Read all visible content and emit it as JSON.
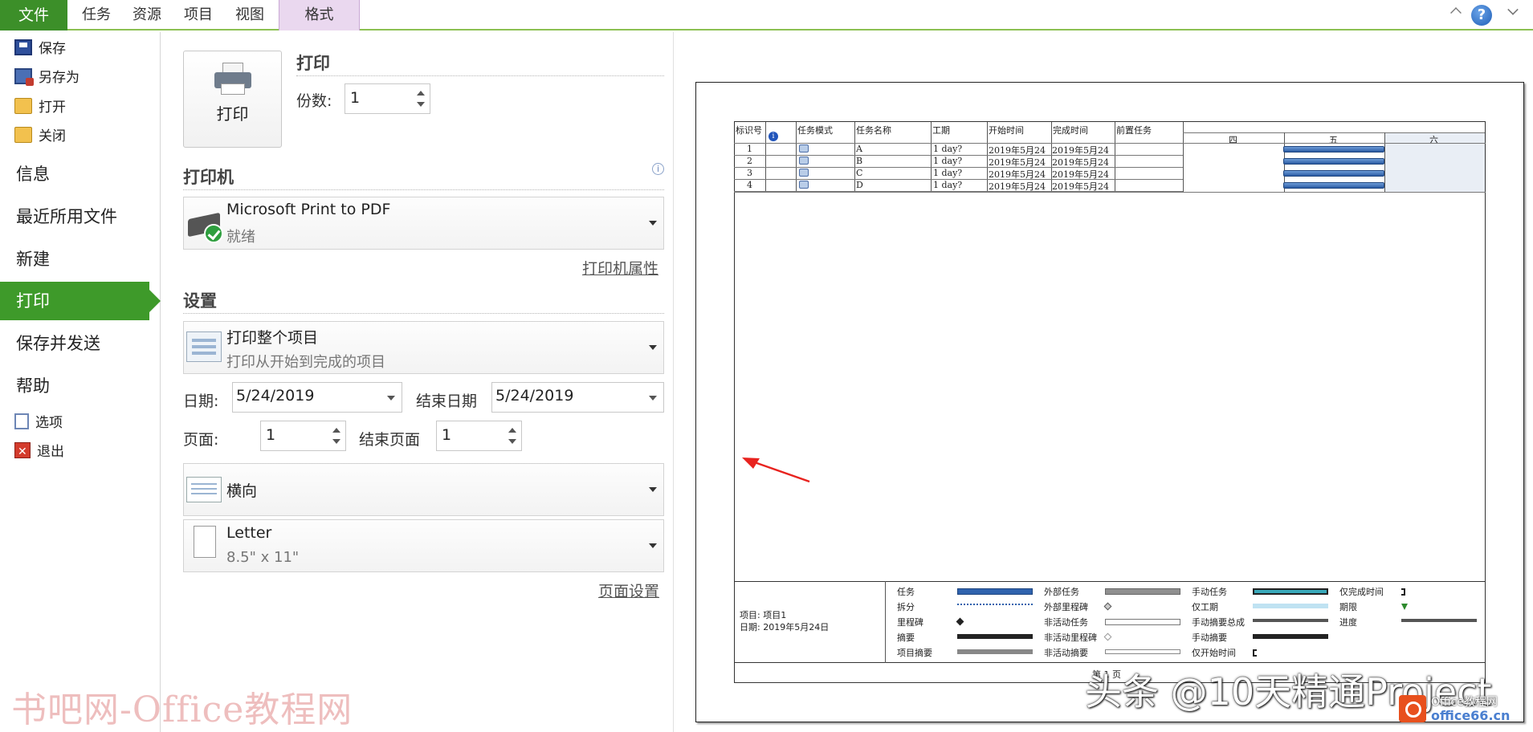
{
  "ribbon": {
    "file_tab": "文件",
    "tabs": [
      "任务",
      "资源",
      "项目",
      "视图"
    ],
    "context_tab": "格式"
  },
  "nav": {
    "commands_top": [
      {
        "label": "保存",
        "icon": "save-icon"
      },
      {
        "label": "另存为",
        "icon": "save-as-icon"
      },
      {
        "label": "打开",
        "icon": "open-folder-icon"
      },
      {
        "label": "关闭",
        "icon": "close-folder-icon"
      }
    ],
    "items": [
      "信息",
      "最近所用文件",
      "新建",
      "打印",
      "保存并发送",
      "帮助"
    ],
    "active_item": "打印",
    "commands_bottom": [
      {
        "label": "选项",
        "icon": "options-icon"
      },
      {
        "label": "退出",
        "icon": "exit-icon"
      }
    ]
  },
  "print": {
    "button_label": "打印",
    "section_title": "打印",
    "copies_label": "份数:",
    "copies_value": "1"
  },
  "printer": {
    "section_title": "打印机",
    "name": "Microsoft Print to PDF",
    "status": "就绪",
    "properties_link": "打印机属性"
  },
  "settings": {
    "section_title": "设置",
    "range_title": "打印整个项目",
    "range_desc": "打印从开始到完成的项目",
    "date_label": "日期:",
    "date_value": "5/24/2019",
    "end_date_label": "结束日期",
    "end_date_value": "5/24/2019",
    "page_label": "页面:",
    "page_value": "1",
    "end_page_label": "结束页面",
    "end_page_value": "1",
    "orientation": "横向",
    "paper_name": "Letter",
    "paper_size": "8.5\" x 11\"",
    "page_setup_link": "页面设置"
  },
  "preview": {
    "columns": [
      "标识号",
      "任务模式",
      "任务名称",
      "工期",
      "开始时间",
      "完成时间",
      "前置任务"
    ],
    "timescale": [
      "四",
      "五",
      "六"
    ],
    "rows": [
      {
        "id": "1",
        "name": "A",
        "duration": "1 day?",
        "start": "2019年5月24",
        "finish": "2019年5月24"
      },
      {
        "id": "2",
        "name": "B",
        "duration": "1 day?",
        "start": "2019年5月24",
        "finish": "2019年5月24"
      },
      {
        "id": "3",
        "name": "C",
        "duration": "1 day?",
        "start": "2019年5月24",
        "finish": "2019年5月24"
      },
      {
        "id": "4",
        "name": "D",
        "duration": "1 day?",
        "start": "2019年5月24",
        "finish": "2019年5月24"
      }
    ],
    "project_label": "项目: 项目1",
    "date_label": "日期: 2019年5月24日",
    "legend_col1": [
      "任务",
      "拆分",
      "里程碑",
      "摘要",
      "项目摘要"
    ],
    "legend_col2": [
      "外部任务",
      "外部里程碑",
      "非活动任务",
      "非活动里程碑",
      "非活动摘要"
    ],
    "legend_col3": [
      "手动任务",
      "仅工期",
      "手动摘要总成",
      "手动摘要",
      "仅开始时间"
    ],
    "legend_col4": [
      "仅完成时间",
      "期限",
      "进度"
    ],
    "footer_text": "第 1 页"
  },
  "watermarks": {
    "left": "书吧网-Office教程网",
    "right": "头条 @10天精通Project",
    "logo_top": "Office教程网",
    "logo_bottom": "office66.cn"
  },
  "colors": {
    "file_tab": "#3c8f29",
    "nav_active": "#3e9a2a",
    "gantt_bar": "#2a5aa3",
    "annotation_arrow": "#e8231f"
  }
}
